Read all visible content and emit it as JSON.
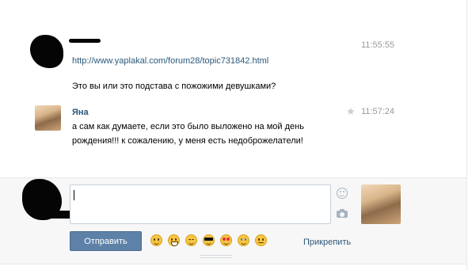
{
  "messages": [
    {
      "author": "",
      "author_redacted": true,
      "time": "11:55:55",
      "link": "http://www.yaplakal.com/forum28/topic731842.html",
      "text": "Это вы или это подстава с пожожими девушками?"
    },
    {
      "author": "Яна",
      "time": "11:57:24",
      "text_line1": "а сам как думаете, если это было выложено на мой день",
      "text_line2": "рождения!!! к сожалению, у меня есть недоброжелатели!"
    }
  ],
  "composer": {
    "input_value": "",
    "send_label": "Отправить",
    "attach_label": "Прикрепить",
    "emojis": [
      "happy-face",
      "grinning-face",
      "relieved-face",
      "cool-face",
      "heart-eyes-face",
      "tear-face",
      "neutral-face"
    ]
  },
  "colors": {
    "link": "#2b587a",
    "send_button": "#5e81a8",
    "timestamp": "#999999",
    "compose_background": "#f7f7f7"
  }
}
